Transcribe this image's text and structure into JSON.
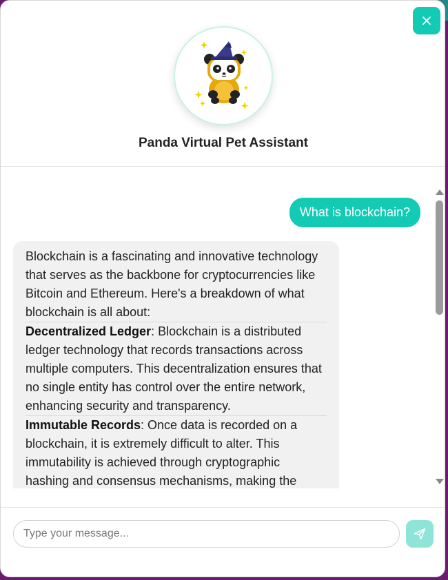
{
  "header": {
    "title": "Panda Virtual Pet Assistant",
    "close_icon": "close-icon",
    "avatar": "panda-wizard-avatar"
  },
  "chat": {
    "user_message": "What is blockchain?",
    "bot_message": {
      "intro": "Blockchain is a fascinating and innovative technology that serves as the backbone for cryptocurrencies like Bitcoin and Ethereum. Here's a breakdown of what blockchain is all about:",
      "points": [
        {
          "term": "Decentralized Ledger",
          "text": ": Blockchain is a distributed ledger technology that records transactions across multiple computers. This decentralization ensures that no single entity has control over the entire network, enhancing security and transparency."
        },
        {
          "term": "Immutable Records",
          "text": ": Once data is recorded on a blockchain, it is extremely difficult to alter. This immutability is achieved through cryptographic hashing and consensus mechanisms, making the"
        }
      ]
    }
  },
  "composer": {
    "placeholder": "Type your message...",
    "value": "",
    "send_icon": "send-icon"
  },
  "colors": {
    "accent": "#13cbb4",
    "send_disabled": "#8fe4d8",
    "bot_bubble": "#f1f1f1"
  }
}
